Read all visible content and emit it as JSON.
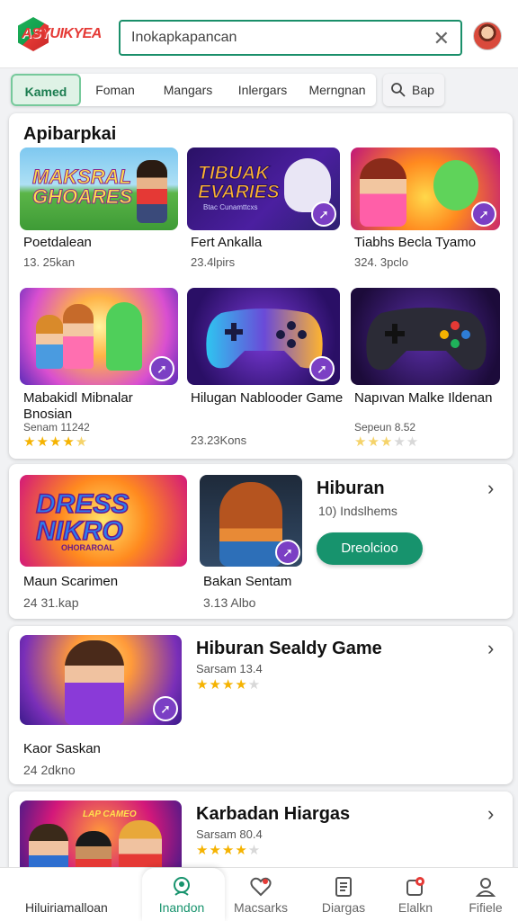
{
  "header": {
    "logo_text": "ASYUIKYEA",
    "search_placeholder": "Inokapkapancan"
  },
  "tabs": [
    {
      "label": "Kamed",
      "active": true
    },
    {
      "label": "Foman"
    },
    {
      "label": "Mangars"
    },
    {
      "label": "Inlergars"
    },
    {
      "label": "Merngnan"
    }
  ],
  "tab_extra": {
    "label": "Bap"
  },
  "section1": {
    "title": "Apibarpkai",
    "tiles": [
      {
        "thumb_text": "MAKSRAL GHOARES",
        "title": "Poetdalean",
        "sub": "13. 25kan"
      },
      {
        "thumb_text": "TIBUAK EVARIES",
        "thumb_sub": "Btac Cunamttcxs",
        "title": "Fert Ankalla",
        "sub": "23.4lpirs"
      },
      {
        "title": "Tiabhs Becla Tyamo",
        "sub": "324. 3pclo"
      },
      {
        "title": "Mabakidl Mibnalar Bnosian",
        "sub": "Senam 11242",
        "rating": 4.5
      },
      {
        "title": "Hilugan Nablooder Game",
        "sub": "23.23Kons"
      },
      {
        "title": "Napıvan Malke Ildenan",
        "sub": "Sepeun 8.52",
        "rating": 3.5
      }
    ]
  },
  "section2": {
    "title": "Hiburan",
    "meta": "10) Indslhems",
    "cta": "Dreolcioo",
    "tiles": [
      {
        "thumb_text": "DRESS NIKRO",
        "thumb_sub": "OHORAROAL",
        "title": "Maun Scarimen",
        "sub": "24 31.kap"
      },
      {
        "title": "Bakan Sentam",
        "sub": "3.13 Albo"
      }
    ]
  },
  "section3": {
    "title": "Hiburan Sealdy Game",
    "meta": "Sarsam 13.4",
    "rating": 4,
    "tile": {
      "title": "Kaor Saskan",
      "sub": "24 2dkno"
    }
  },
  "section4": {
    "title": "Karbadan Hiargas",
    "meta": "Sarsam 80.4",
    "rating": 4,
    "thumb_text": "LAP CAMEO"
  },
  "bottom_nav": {
    "left_label": "Hiluiriamalloan",
    "items": [
      {
        "label": "Inandon",
        "icon": "home-icon",
        "active": true
      },
      {
        "label": "Macsarks",
        "icon": "heart-icon"
      },
      {
        "label": "Diargas",
        "icon": "document-icon"
      },
      {
        "label": "Elalkn",
        "icon": "location-icon"
      },
      {
        "label": "Fifiele",
        "icon": "profile-icon"
      }
    ]
  },
  "colors": {
    "accent": "#17936d",
    "star": "#f5b301",
    "badge": "#7b3fc4"
  }
}
